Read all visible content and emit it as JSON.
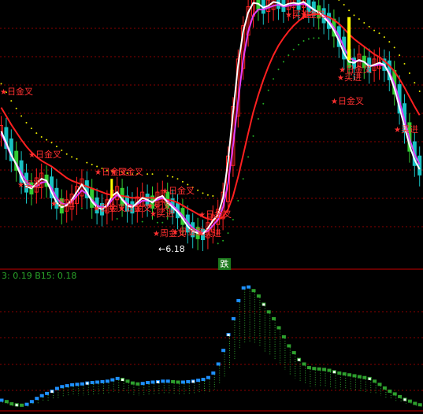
{
  "colors": {
    "background": "#000000",
    "grid_dotted": "#8b0000",
    "divider": "#c80000",
    "candle_up": "#ff2020",
    "candle_down": "#19c2c2",
    "candle_green": "#33cc33",
    "ma_white": "#ffffff",
    "ma_magenta": "#e040ff",
    "ma_red": "#ff2020",
    "sar_yellow": "#e8e800",
    "sar_green": "#22aa22",
    "signal_text": "#ff3030",
    "buy_yellow": "#ffff00",
    "osc_blue": "#1e90ff",
    "osc_green": "#2ea02e",
    "osc_white": "#ffffff",
    "header_text": "#2aa52a",
    "badge_bg": "#1d7a1d",
    "badge_text": "#ffffff"
  },
  "price_panel": {
    "low_marker": "6.18",
    "low_marker_arrow": "←",
    "badge": "跌",
    "signals": [
      {
        "text": "日金叉"
      },
      {
        "text": "日金叉"
      },
      {
        "text": "买进"
      },
      {
        "text": "日金叉"
      },
      {
        "text": "日金叉"
      },
      {
        "text": "买进"
      },
      {
        "text": "日金叉"
      },
      {
        "text": "日金叉"
      },
      {
        "text": "买进"
      },
      {
        "text": "日金叉"
      },
      {
        "text": "周金叉"
      },
      {
        "text": "日金叉"
      },
      {
        "text": "死叉"
      },
      {
        "text": "买进"
      },
      {
        "text": "日金叉"
      },
      {
        "text": "买进"
      },
      {
        "text": "买进"
      },
      {
        "text": "日金叉"
      },
      {
        "text": "买进"
      },
      {
        "text": "日金叉"
      },
      {
        "text": "金叉"
      }
    ]
  },
  "indicator_header": {
    "text": "3: 0.19  B15: 0.18"
  },
  "chart_data": [
    {
      "type": "line",
      "series": [
        {
          "values": [
            7.3,
            7.18,
            7.05,
            6.95,
            6.82,
            6.72,
            6.7,
            6.75,
            6.8,
            6.78,
            6.66,
            6.55,
            6.5,
            6.52,
            6.58,
            6.66,
            6.74,
            6.66,
            6.56,
            6.5,
            6.48,
            6.52,
            6.62,
            6.66,
            6.58,
            6.52,
            6.5,
            6.55,
            6.6,
            6.58,
            6.55,
            6.6,
            6.62,
            6.55,
            6.5,
            6.45,
            6.38,
            6.3,
            6.25,
            6.23,
            6.22,
            6.28,
            6.36,
            6.42,
            6.6,
            6.98,
            7.5,
            8.0,
            8.35,
            8.55,
            8.65,
            8.64,
            8.6,
            8.62,
            8.66,
            8.65,
            8.62,
            8.64,
            8.65,
            8.64,
            8.66,
            8.62,
            8.58,
            8.55,
            8.5,
            8.44,
            8.36,
            8.25,
            8.12,
            8.03,
            8.02,
            8.05,
            8.03,
            7.98,
            8.0,
            8.02,
            8.0,
            7.9,
            7.75,
            7.55,
            7.35,
            7.15,
            7.0,
            6.9
          ]
        },
        {
          "values": [
            7.28,
            7.16,
            7.04,
            6.96,
            6.86,
            6.77,
            6.72,
            6.72,
            6.76,
            6.77,
            6.7,
            6.6,
            6.54,
            6.53,
            6.56,
            6.62,
            6.68,
            6.64,
            6.58,
            6.52,
            6.5,
            6.51,
            6.58,
            6.63,
            6.59,
            6.54,
            6.51,
            6.53,
            6.57,
            6.57,
            6.56,
            6.58,
            6.6,
            6.57,
            6.52,
            6.47,
            6.41,
            6.34,
            6.28,
            6.25,
            6.23,
            6.25,
            6.31,
            6.37,
            6.5,
            6.75,
            7.15,
            7.62,
            8.05,
            8.35,
            8.52,
            8.58,
            8.58,
            8.6,
            8.62,
            8.63,
            8.61,
            8.62,
            8.63,
            8.63,
            8.64,
            8.61,
            8.58,
            8.55,
            8.51,
            8.46,
            8.39,
            8.3,
            8.18,
            8.08,
            8.04,
            8.04,
            8.03,
            7.99,
            7.99,
            8.0,
            7.99,
            7.92,
            7.8,
            7.62,
            7.42,
            7.22,
            7.06,
            6.95
          ]
        },
        {
          "values": [
            7.55,
            7.46,
            7.37,
            7.29,
            7.21,
            7.14,
            7.08,
            7.03,
            6.99,
            6.96,
            6.93,
            6.89,
            6.85,
            6.81,
            6.78,
            6.76,
            6.74,
            6.72,
            6.7,
            6.68,
            6.66,
            6.64,
            6.63,
            6.63,
            6.62,
            6.61,
            6.6,
            6.6,
            6.6,
            6.6,
            6.6,
            6.59,
            6.59,
            6.58,
            6.57,
            6.55,
            6.52,
            6.49,
            6.46,
            6.43,
            6.4,
            6.38,
            6.37,
            6.37,
            6.4,
            6.48,
            6.62,
            6.82,
            7.05,
            7.28,
            7.5,
            7.68,
            7.84,
            7.98,
            8.1,
            8.2,
            8.28,
            8.35,
            8.41,
            8.46,
            8.5,
            8.52,
            8.53,
            8.53,
            8.52,
            8.5,
            8.47,
            8.43,
            8.38,
            8.32,
            8.27,
            8.23,
            8.19,
            8.15,
            8.11,
            8.08,
            8.04,
            7.99,
            7.93,
            7.85,
            7.76,
            7.66,
            7.56,
            7.47
          ]
        }
      ]
    },
    {
      "type": "line",
      "series": [
        {
          "values": [
            0.02,
            0.017,
            0.012,
            0.01,
            0.009,
            0.011,
            0.017,
            0.024,
            0.03,
            0.035,
            0.04,
            0.046,
            0.05,
            0.052,
            0.054,
            0.055,
            0.056,
            0.058,
            0.059,
            0.06,
            0.061,
            0.062,
            0.065,
            0.068,
            0.066,
            0.062,
            0.058,
            0.056,
            0.057,
            0.059,
            0.06,
            0.061,
            0.062,
            0.062,
            0.061,
            0.06,
            0.06,
            0.061,
            0.062,
            0.064,
            0.066,
            0.07,
            0.08,
            0.1,
            0.13,
            0.165,
            0.2,
            0.24,
            0.268,
            0.27,
            0.262,
            0.25,
            0.232,
            0.215,
            0.2,
            0.18,
            0.16,
            0.14,
            0.125,
            0.11,
            0.1,
            0.092,
            0.09,
            0.089,
            0.088,
            0.086,
            0.083,
            0.08,
            0.078,
            0.076,
            0.074,
            0.072,
            0.07,
            0.068,
            0.062,
            0.055,
            0.047,
            0.04,
            0.034,
            0.028,
            0.022,
            0.018,
            0.013,
            0.01
          ]
        }
      ]
    }
  ]
}
